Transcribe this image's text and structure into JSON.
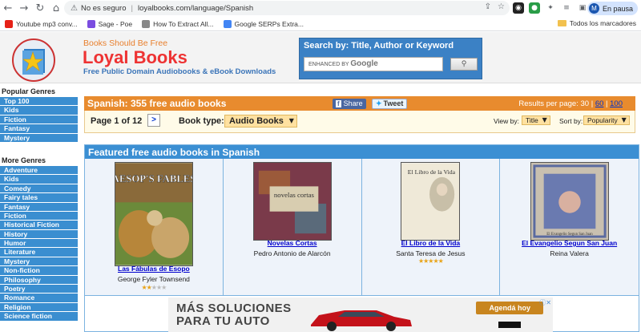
{
  "browser": {
    "security_label": "No es seguro",
    "url": "loyalbooks.com/language/Spanish",
    "profile_label": "En pausa",
    "profile_initial": "M"
  },
  "bookmarks": [
    {
      "label": "Youtube mp3 conv...",
      "color": "#e62117"
    },
    {
      "label": "Sage - Poe",
      "color": "#7b4de0"
    },
    {
      "label": "How To Extract All...",
      "color": "#888888"
    },
    {
      "label": "Google SERPs Extra...",
      "color": "#4285f4"
    }
  ],
  "bookmarks_folder": "Todos los marcadores",
  "site": {
    "tagline": "Books Should Be Free",
    "name": "Loyal Books",
    "subtitle": "Free Public Domain Audiobooks & eBook Downloads"
  },
  "search": {
    "title": "Search by: Title, Author or Keyword",
    "enhanced_label": "ENHANCED BY",
    "google": "Google"
  },
  "sidebar": {
    "popular_heading": "Popular Genres",
    "popular": [
      "Top 100",
      "Kids",
      "Fiction",
      "Fantasy",
      "Mystery"
    ],
    "more_heading": "More Genres",
    "more": [
      "Adventure",
      "Kids",
      "Comedy",
      "Fairy tales",
      "Fantasy",
      "Fiction",
      "Historical Fiction",
      "History",
      "Humor",
      "Literature",
      "Mystery",
      "Non-fiction",
      "Philosophy",
      "Poetry",
      "Romance",
      "Religion",
      "Science fiction"
    ]
  },
  "main": {
    "title": "Spanish: 355 free audio books",
    "share_label": "Share",
    "tweet_label": "Tweet",
    "results_per_page_label": "Results per page:",
    "rpp_current": "30",
    "rpp_sep": "|",
    "rpp_60": "60",
    "rpp_100": "100",
    "page_label": "Page 1 of 12",
    "next_label": ">",
    "book_type_label": "Book type:",
    "book_type_value": "Audio Books",
    "view_by_label": "View by:",
    "view_by_value": "Title",
    "sort_by_label": "Sort by:",
    "sort_by_value": "Popularity"
  },
  "featured": {
    "heading": "Featured free audio books in Spanish",
    "books": [
      {
        "title": "Las Fábulas de Esopo",
        "author": "George Fyler Townsend",
        "rating": 2,
        "cover_text": "AESOP'S FABLES"
      },
      {
        "title": "Novelas Cortas",
        "author": "Pedro Antonio de Alarcón",
        "rating": 0,
        "cover_text": "novelas cortas"
      },
      {
        "title": "El Libro de la Vida",
        "author": "Santa Teresa de Jesus",
        "rating": 5,
        "cover_text": "El Libro de la Vida"
      },
      {
        "title": "El Evangelio Segun San Juan",
        "author": "Reina Valera",
        "rating": 0,
        "cover_text": "El Evangelio Segun San Juan"
      }
    ]
  },
  "ad": {
    "text_line1": "MÁS SOLUCIONES",
    "text_line2": "PARA TU AUTO",
    "cta": "Agendá hoy"
  }
}
